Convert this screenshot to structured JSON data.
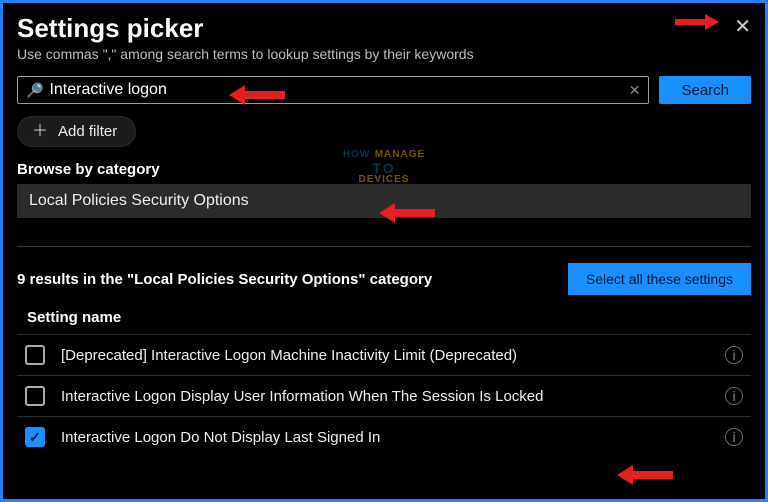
{
  "header": {
    "title": "Settings picker",
    "subtitle": "Use commas \",\" among search terms to lookup settings by their keywords"
  },
  "search": {
    "value": "Interactive logon",
    "button": "Search"
  },
  "add_filter_label": "Add filter",
  "browse": {
    "label": "Browse by category",
    "category": "Local Policies Security Options"
  },
  "results": {
    "summary": "9 results in the \"Local Policies Security Options\" category",
    "select_all": "Select all these settings",
    "column": "Setting name",
    "items": [
      {
        "checked": false,
        "name": "[Deprecated] Interactive Logon Machine Inactivity Limit (Deprecated)"
      },
      {
        "checked": false,
        "name": "Interactive Logon Display User Information When The Session Is Locked"
      },
      {
        "checked": true,
        "name": "Interactive Logon Do Not Display Last Signed In"
      }
    ]
  },
  "watermark": {
    "l1a": "HOW",
    "l1b": "MANAGE",
    "l2": "TO",
    "l3": "DEVICES"
  }
}
